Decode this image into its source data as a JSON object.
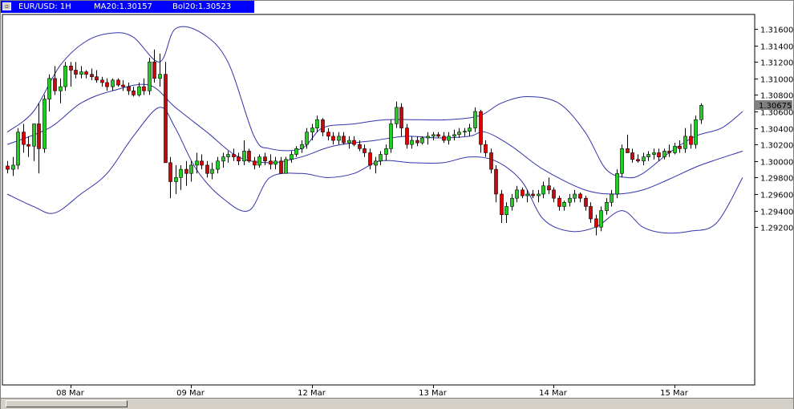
{
  "header": {
    "symbol": "EUR/USD: 1H",
    "ma": "MA20:1.30157",
    "bol": "Bol20:1.30523"
  },
  "colors": {
    "title_bar": "#0000ff",
    "bull_candle": "#22cc22",
    "bear_candle": "#dd0000",
    "band_line": "#3333aa",
    "grid": "#000000",
    "price_marker": "#808080"
  },
  "icons": {
    "window_icon": "chart-window-icon"
  },
  "chart_data": {
    "type": "candlestick",
    "title": "",
    "series": [
      {
        "name": "EUR/USD: 1H"
      },
      {
        "name": "MA20"
      },
      {
        "name": "Bol20"
      }
    ],
    "current_price": "1.30675",
    "ylim": [
      1.29,
      1.317
    ],
    "y_ticks": [
      "1.31600",
      "1.31400",
      "1.31200",
      "1.31000",
      "1.30800",
      "1.30600",
      "1.30400",
      "1.30200",
      "1.30000",
      "1.29800",
      "1.29600",
      "1.29400",
      "1.29200"
    ],
    "x_labels": [
      "08 Mar",
      "09 Mar",
      "12 Mar",
      "13 Mar",
      "14 Mar",
      "15 Mar"
    ],
    "grid": false,
    "candles": [
      [
        1.2994,
        1.3,
        1.2985,
        1.299
      ],
      [
        1.299,
        1.3005,
        1.2982,
        1.2995
      ],
      [
        1.2995,
        1.304,
        1.299,
        1.3035
      ],
      [
        1.3035,
        1.3045,
        1.301,
        1.302
      ],
      [
        1.302,
        1.303,
        1.3005,
        1.3018
      ],
      [
        1.3018,
        1.3045,
        1.3,
        1.3045
      ],
      [
        1.3045,
        1.307,
        1.2985,
        1.3015
      ],
      [
        1.3015,
        1.308,
        1.301,
        1.3075
      ],
      [
        1.3075,
        1.3105,
        1.306,
        1.31
      ],
      [
        1.31,
        1.3115,
        1.308,
        1.3085
      ],
      [
        1.3085,
        1.31,
        1.307,
        1.309
      ],
      [
        1.309,
        1.312,
        1.3085,
        1.3115
      ],
      [
        1.3115,
        1.312,
        1.309,
        1.311
      ],
      [
        1.311,
        1.312,
        1.31,
        1.3105
      ],
      [
        1.3105,
        1.3115,
        1.31,
        1.3108
      ],
      [
        1.3108,
        1.311,
        1.31,
        1.3105
      ],
      [
        1.3105,
        1.3112,
        1.3098,
        1.3102
      ],
      [
        1.3102,
        1.311,
        1.3095,
        1.3098
      ],
      [
        1.3098,
        1.3102,
        1.309,
        1.3095
      ],
      [
        1.3095,
        1.31,
        1.3085,
        1.309
      ],
      [
        1.309,
        1.31,
        1.3085,
        1.3098
      ],
      [
        1.3098,
        1.31,
        1.309,
        1.3092
      ],
      [
        1.3092,
        1.3098,
        1.3085,
        1.309
      ],
      [
        1.309,
        1.3095,
        1.308,
        1.3085
      ],
      [
        1.3085,
        1.309,
        1.3078,
        1.308
      ],
      [
        1.308,
        1.3095,
        1.3078,
        1.309
      ],
      [
        1.309,
        1.31,
        1.308,
        1.3085
      ],
      [
        1.3085,
        1.3125,
        1.308,
        1.312
      ],
      [
        1.312,
        1.3135,
        1.3095,
        1.31
      ],
      [
        1.31,
        1.313,
        1.309,
        1.3105
      ],
      [
        1.3105,
        1.312,
        1.309,
        1.2998
      ],
      [
        1.2998,
        1.3005,
        1.2955,
        1.2975
      ],
      [
        1.2975,
        1.2995,
        1.296,
        1.298
      ],
      [
        1.298,
        1.2995,
        1.2965,
        1.299
      ],
      [
        1.299,
        1.3,
        1.297,
        1.2985
      ],
      [
        1.2985,
        1.3,
        1.2975,
        1.2995
      ],
      [
        1.2995,
        1.301,
        1.2985,
        1.3
      ],
      [
        1.3,
        1.3008,
        1.299,
        1.2995
      ],
      [
        1.2995,
        1.3,
        1.298,
        1.2985
      ],
      [
        1.2985,
        1.2998,
        1.2978,
        1.299
      ],
      [
        1.299,
        1.3005,
        1.2985,
        1.3
      ],
      [
        1.3,
        1.301,
        1.2992,
        1.3005
      ],
      [
        1.3005,
        1.3012,
        1.2998,
        1.3008
      ],
      [
        1.3008,
        1.3015,
        1.3,
        1.3005
      ],
      [
        1.3005,
        1.301,
        1.2995,
        1.3
      ],
      [
        1.3,
        1.3025,
        1.2995,
        1.3012
      ],
      [
        1.3012,
        1.3015,
        1.2998,
        1.3
      ],
      [
        1.3,
        1.3005,
        1.299,
        1.2995
      ],
      [
        1.2995,
        1.3008,
        1.2992,
        1.3005
      ],
      [
        1.3005,
        1.301,
        1.2995,
        1.3
      ],
      [
        1.3,
        1.3008,
        1.299,
        1.2996
      ],
      [
        1.2996,
        1.3005,
        1.299,
        1.3
      ],
      [
        1.3,
        1.3005,
        1.2985,
        1.2985
      ],
      [
        1.2985,
        1.3005,
        1.2985,
        1.3002
      ],
      [
        1.3002,
        1.3012,
        1.2998,
        1.3008
      ],
      [
        1.3008,
        1.3018,
        1.3005,
        1.3015
      ],
      [
        1.3015,
        1.3025,
        1.301,
        1.302
      ],
      [
        1.302,
        1.304,
        1.3015,
        1.3035
      ],
      [
        1.3035,
        1.3045,
        1.3025,
        1.304
      ],
      [
        1.304,
        1.3055,
        1.3035,
        1.305
      ],
      [
        1.305,
        1.3052,
        1.303,
        1.3035
      ],
      [
        1.3035,
        1.304,
        1.3025,
        1.303
      ],
      [
        1.303,
        1.3035,
        1.302,
        1.3025
      ],
      [
        1.3025,
        1.3035,
        1.302,
        1.303
      ],
      [
        1.303,
        1.3035,
        1.302,
        1.3022
      ],
      [
        1.3022,
        1.303,
        1.3015,
        1.3025
      ],
      [
        1.3025,
        1.303,
        1.3018,
        1.302
      ],
      [
        1.302,
        1.3025,
        1.3012,
        1.3015
      ],
      [
        1.3015,
        1.302,
        1.3005,
        1.301
      ],
      [
        1.301,
        1.3015,
        1.299,
        1.2995
      ],
      [
        1.2995,
        1.3005,
        1.2985,
        1.3
      ],
      [
        1.3,
        1.3012,
        1.2995,
        1.3008
      ],
      [
        1.3008,
        1.302,
        1.3,
        1.3015
      ],
      [
        1.3015,
        1.305,
        1.301,
        1.3045
      ],
      [
        1.3045,
        1.3072,
        1.304,
        1.3065
      ],
      [
        1.3065,
        1.307,
        1.303,
        1.304
      ],
      [
        1.304,
        1.3045,
        1.3015,
        1.302
      ],
      [
        1.302,
        1.303,
        1.3015,
        1.3025
      ],
      [
        1.3025,
        1.303,
        1.3018,
        1.3022
      ],
      [
        1.3022,
        1.303,
        1.302,
        1.3028
      ],
      [
        1.3028,
        1.3035,
        1.302,
        1.303
      ],
      [
        1.303,
        1.3035,
        1.3025,
        1.3032
      ],
      [
        1.3032,
        1.3035,
        1.3028,
        1.303
      ],
      [
        1.303,
        1.3035,
        1.3022,
        1.3025
      ],
      [
        1.3025,
        1.3035,
        1.302,
        1.303
      ],
      [
        1.303,
        1.3038,
        1.3025,
        1.3032
      ],
      [
        1.3032,
        1.304,
        1.3028,
        1.3035
      ],
      [
        1.3035,
        1.304,
        1.303,
        1.3036
      ],
      [
        1.3036,
        1.3045,
        1.303,
        1.304
      ],
      [
        1.304,
        1.3065,
        1.3035,
        1.306
      ],
      [
        1.306,
        1.3062,
        1.301,
        1.302
      ],
      [
        1.302,
        1.3025,
        1.3005,
        1.301
      ],
      [
        1.301,
        1.3015,
        1.2985,
        1.299
      ],
      [
        1.299,
        1.2995,
        1.295,
        1.296
      ],
      [
        1.296,
        1.2965,
        1.2925,
        1.2935
      ],
      [
        1.2935,
        1.295,
        1.2925,
        1.2945
      ],
      [
        1.2945,
        1.296,
        1.294,
        1.2955
      ],
      [
        1.2955,
        1.297,
        1.295,
        1.2965
      ],
      [
        1.2965,
        1.2968,
        1.2955,
        1.2958
      ],
      [
        1.2958,
        1.2965,
        1.295,
        1.296
      ],
      [
        1.296,
        1.2965,
        1.2955,
        1.2958
      ],
      [
        1.2958,
        1.2965,
        1.295,
        1.296
      ],
      [
        1.296,
        1.2975,
        1.2955,
        1.297
      ],
      [
        1.297,
        1.298,
        1.296,
        1.2965
      ],
      [
        1.2965,
        1.2968,
        1.295,
        1.2955
      ],
      [
        1.2955,
        1.2958,
        1.294,
        1.2945
      ],
      [
        1.2945,
        1.2952,
        1.294,
        1.295
      ],
      [
        1.295,
        1.296,
        1.2945,
        1.2955
      ],
      [
        1.2955,
        1.2965,
        1.295,
        1.296
      ],
      [
        1.296,
        1.2962,
        1.295,
        1.2955
      ],
      [
        1.2955,
        1.2958,
        1.294,
        1.2945
      ],
      [
        1.2945,
        1.295,
        1.2925,
        1.293
      ],
      [
        1.293,
        1.2935,
        1.291,
        1.292
      ],
      [
        1.292,
        1.2945,
        1.2915,
        1.294
      ],
      [
        1.294,
        1.2955,
        1.2935,
        1.295
      ],
      [
        1.295,
        1.2965,
        1.2945,
        1.296
      ],
      [
        1.296,
        1.299,
        1.2955,
        1.2985
      ],
      [
        1.2985,
        1.302,
        1.298,
        1.3015
      ],
      [
        1.3015,
        1.3032,
        1.301,
        1.301
      ],
      [
        1.301,
        1.3015,
        1.2998,
        1.3002
      ],
      [
        1.3002,
        1.3008,
        1.2998,
        1.3
      ],
      [
        1.3,
        1.301,
        1.2995,
        1.3005
      ],
      [
        1.3005,
        1.3012,
        1.3,
        1.3008
      ],
      [
        1.3008,
        1.3015,
        1.3002,
        1.301
      ],
      [
        1.301,
        1.3015,
        1.3,
        1.3005
      ],
      [
        1.3005,
        1.3015,
        1.3002,
        1.3012
      ],
      [
        1.3012,
        1.302,
        1.3005,
        1.301
      ],
      [
        1.301,
        1.3022,
        1.3008,
        1.3018
      ],
      [
        1.3018,
        1.3025,
        1.301,
        1.3015
      ],
      [
        1.3015,
        1.304,
        1.301,
        1.303
      ],
      [
        1.303,
        1.3045,
        1.3015,
        1.302
      ],
      [
        1.302,
        1.3055,
        1.3015,
        1.305
      ],
      [
        1.305,
        1.307,
        1.3045,
        1.30675
      ]
    ],
    "ma20": [
      [
        0,
        1.302
      ],
      [
        8,
        1.304
      ],
      [
        14,
        1.307
      ],
      [
        20,
        1.3085
      ],
      [
        27,
        1.3092
      ],
      [
        32,
        1.3065
      ],
      [
        38,
        1.3035
      ],
      [
        44,
        1.3005
      ],
      [
        50,
        1.2998
      ],
      [
        56,
        1.3005
      ],
      [
        62,
        1.3018
      ],
      [
        70,
        1.3025
      ],
      [
        76,
        1.303
      ],
      [
        82,
        1.3028
      ],
      [
        88,
        1.303
      ],
      [
        91,
        1.3035
      ],
      [
        96,
        1.3018
      ],
      [
        102,
        1.299
      ],
      [
        110,
        1.2965
      ],
      [
        116,
        1.296
      ],
      [
        121,
        1.2965
      ],
      [
        126,
        1.2978
      ],
      [
        132,
        1.2995
      ],
      [
        140,
        1.3012
      ]
    ],
    "bol_upper": [
      [
        0,
        1.3035
      ],
      [
        5,
        1.306
      ],
      [
        10,
        1.3115
      ],
      [
        15,
        1.3145
      ],
      [
        20,
        1.3155
      ],
      [
        24,
        1.315
      ],
      [
        29,
        1.312
      ],
      [
        32,
        1.316
      ],
      [
        37,
        1.3155
      ],
      [
        42,
        1.312
      ],
      [
        47,
        1.303
      ],
      [
        50,
        1.3015
      ],
      [
        56,
        1.3015
      ],
      [
        60,
        1.304
      ],
      [
        66,
        1.3045
      ],
      [
        72,
        1.305
      ],
      [
        78,
        1.305
      ],
      [
        84,
        1.305
      ],
      [
        90,
        1.3055
      ],
      [
        94,
        1.307
      ],
      [
        99,
        1.3078
      ],
      [
        105,
        1.307
      ],
      [
        110,
        1.3035
      ],
      [
        114,
        1.299
      ],
      [
        118,
        1.298
      ],
      [
        121,
        1.2985
      ],
      [
        126,
        1.301
      ],
      [
        131,
        1.303
      ],
      [
        136,
        1.304
      ],
      [
        140,
        1.306
      ]
    ],
    "bol_lower": [
      [
        0,
        1.296
      ],
      [
        5,
        1.2945
      ],
      [
        9,
        1.2937
      ],
      [
        14,
        1.296
      ],
      [
        19,
        1.2985
      ],
      [
        24,
        1.303
      ],
      [
        29,
        1.3065
      ],
      [
        32,
        1.304
      ],
      [
        36,
        1.299
      ],
      [
        41,
        1.2955
      ],
      [
        46,
        1.294
      ],
      [
        50,
        1.298
      ],
      [
        56,
        1.2985
      ],
      [
        61,
        1.298
      ],
      [
        66,
        1.2985
      ],
      [
        71,
        1.3
      ],
      [
        77,
        1.2998
      ],
      [
        83,
        1.2998
      ],
      [
        88,
        1.3005
      ],
      [
        93,
        1.3
      ],
      [
        98,
        1.2975
      ],
      [
        102,
        1.293
      ],
      [
        107,
        1.2915
      ],
      [
        112,
        1.292
      ],
      [
        117,
        1.294
      ],
      [
        121,
        1.292
      ],
      [
        125,
        1.2913
      ],
      [
        130,
        1.2915
      ],
      [
        135,
        1.2925
      ],
      [
        140,
        1.298
      ]
    ]
  }
}
